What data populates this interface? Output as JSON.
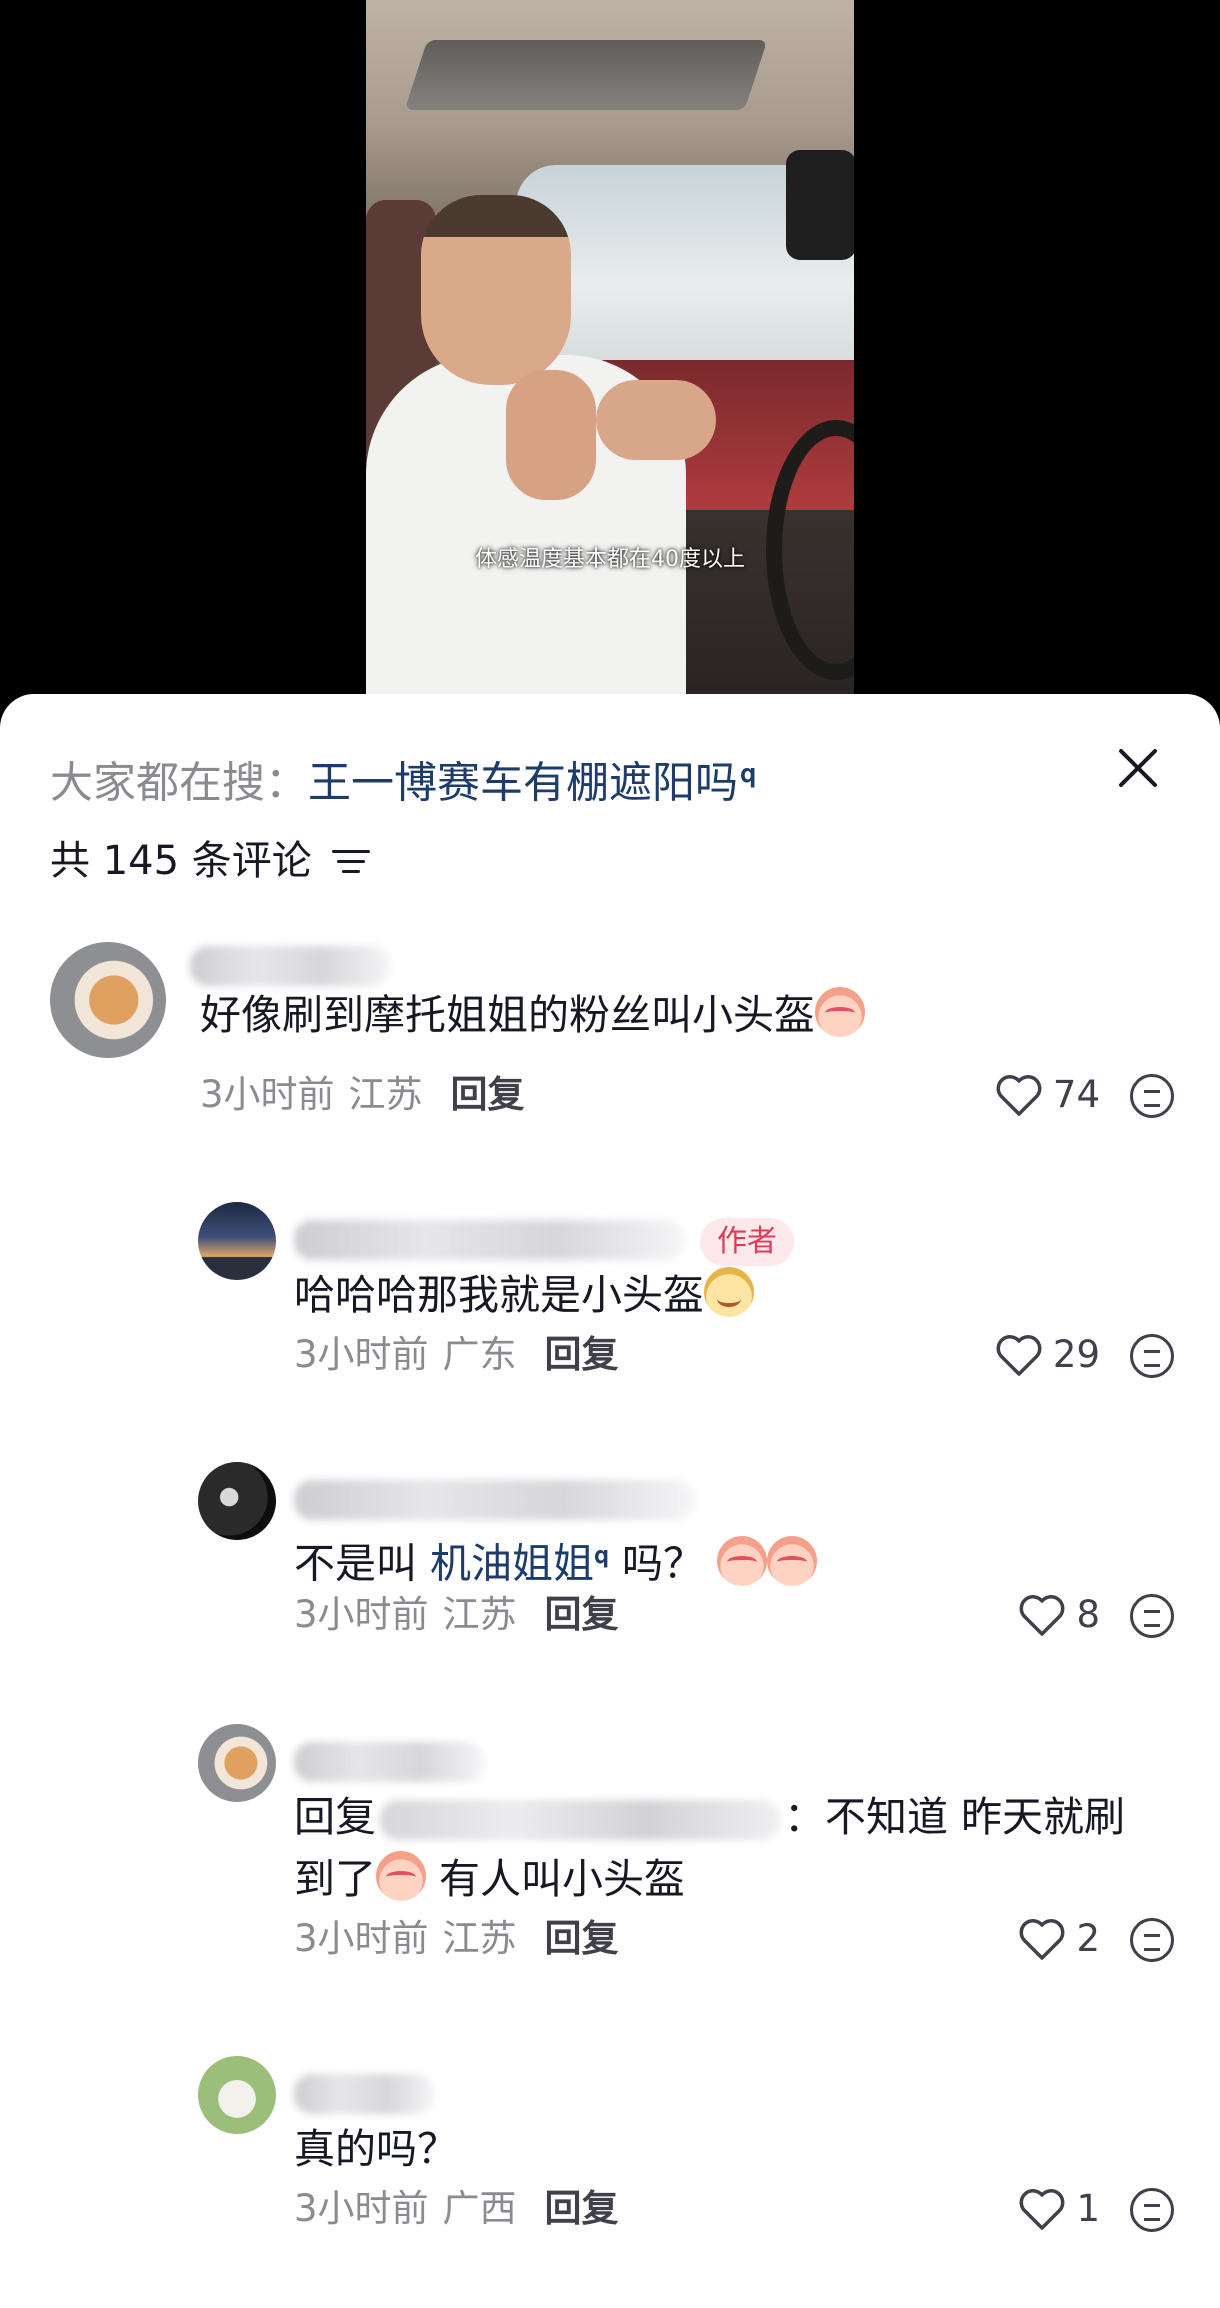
{
  "video": {
    "subtitle": "体感温度基本都在40度以上"
  },
  "header": {
    "hot_search_label": "大家都在搜：",
    "hot_search_query": "王一博赛车有棚遮阳吗",
    "comment_count_text": "共 145 条评论"
  },
  "comments": [
    {
      "text": "好像刷到摩托姐姐的粉丝叫小头盔",
      "time": "3小时前",
      "location": "江苏",
      "reply_label": "回复",
      "likes": "74"
    },
    {
      "author_tag": "作者",
      "text": "哈哈哈那我就是小头盔",
      "time": "3小时前",
      "location": "广东",
      "reply_label": "回复",
      "likes": "29"
    },
    {
      "text_prefix": "不是叫",
      "link_text": "机油姐姐",
      "text_suffix": "吗？",
      "time": "3小时前",
      "location": "江苏",
      "reply_label": "回复",
      "likes": "8"
    },
    {
      "reply_prefix": "回复",
      "text_part1": "：不知道 昨天就刷",
      "text_part2_a": "到了",
      "text_part2_b": "有人叫小头盔",
      "time": "3小时前",
      "location": "江苏",
      "reply_label": "回复",
      "likes": "2"
    },
    {
      "text": "真的吗？",
      "time": "3小时前",
      "location": "广西",
      "reply_label": "回复",
      "likes": "1"
    }
  ],
  "icons": {
    "search_hint": "search-hint-icon",
    "close": "close-icon",
    "filter": "filter-icon",
    "like": "heart-icon",
    "dislike": "dislike-face-icon"
  },
  "colors": {
    "link": "#1d3b6b",
    "author_tag_bg": "#fde9ec",
    "author_tag_text": "#e23a55",
    "muted": "#8a8b91"
  }
}
